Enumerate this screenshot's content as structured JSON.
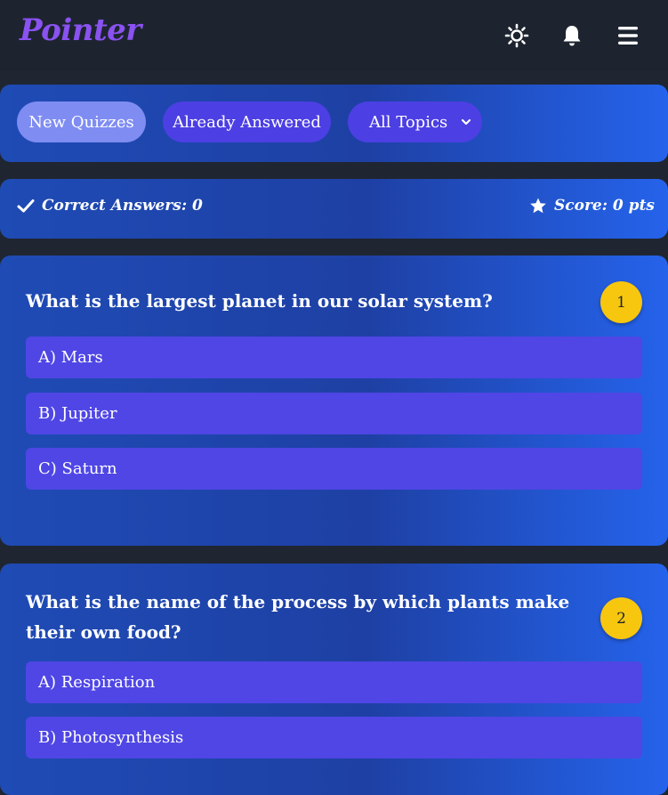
{
  "app": {
    "logo": "Pointer"
  },
  "header": {
    "icons": [
      "sun-icon",
      "bell-icon",
      "menu-icon"
    ]
  },
  "filters": {
    "new_quizzes": "New Quizzes",
    "already_answered": "Already Answered",
    "topics_selected": "All Topics"
  },
  "stats": {
    "correct_label": "Correct Answers: 0",
    "score_label": "Score: 0 pts"
  },
  "quizzes": [
    {
      "number": "1",
      "question": "What is the largest planet in our solar system?",
      "options": [
        "A) Mars",
        "B) Jupiter",
        "C) Saturn"
      ]
    },
    {
      "number": "2",
      "question": "What is the name of the process by which plants make their own food?",
      "options": [
        "A) Respiration",
        "B) Photosynthesis"
      ]
    }
  ],
  "colors": {
    "background": "#1f2632",
    "panel": "#1e40a4",
    "accent": "#4f46e5",
    "active_pill": "#7f8cf2",
    "badge": "#f7c60f",
    "logo": "#8a52f0"
  }
}
